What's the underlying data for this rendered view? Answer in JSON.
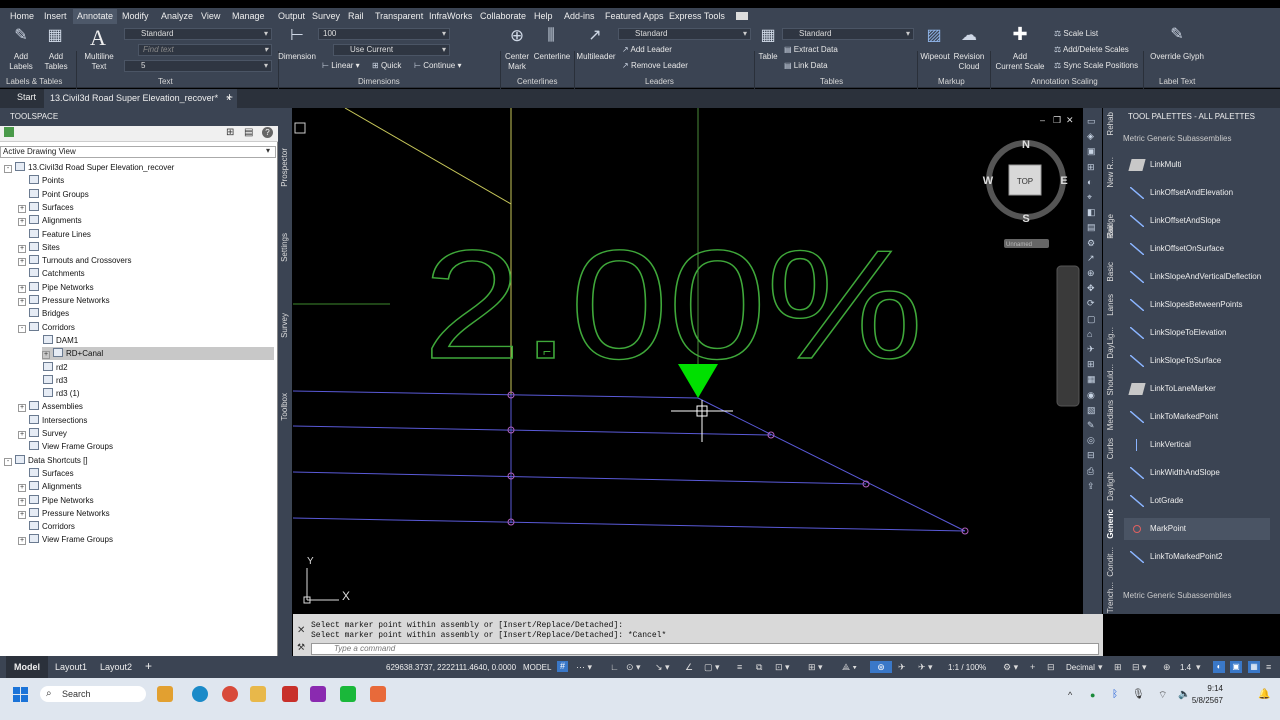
{
  "menu": [
    "Home",
    "Insert",
    "Annotate",
    "Modify",
    "Analyze",
    "View",
    "Manage",
    "Output",
    "Survey",
    "Rail",
    "Transparent",
    "InfraWorks",
    "Collaborate",
    "Help",
    "Add-ins",
    "Featured Apps",
    "Express Tools"
  ],
  "ribbon": {
    "add_labels": "Add\nLabels",
    "add_tables": "Add\nTables",
    "multiline_text": "Multiline\nText",
    "text_style": "Standard",
    "find_text_placeholder": "Find text",
    "text_height": "5",
    "dimension": "Dimension",
    "dim_scale": "100",
    "use_current": "Use Current",
    "linear": "Linear",
    "quick": "Quick",
    "continue": "Continue",
    "center_mark": "Center\nMark",
    "centerline": "Centerline",
    "multileader": "Multileader",
    "leader_style": "Standard",
    "add_leader": "Add Leader",
    "remove_leader": "Remove Leader",
    "table": "Table",
    "table_style": "Standard",
    "extract_data": "Extract Data",
    "link_data": "Link Data",
    "wipeout": "Wipeout",
    "revision_cloud": "Revision\nCloud",
    "add_current_scale": "Add\nCurrent Scale",
    "scale_list": "Scale List",
    "add_delete_scales": "Add/Delete Scales",
    "sync_scale_positions": "Sync Scale Positions",
    "override_glyph": "Override Glyph",
    "groups": {
      "labels_tables": "Labels & Tables",
      "text": "Text",
      "dimensions": "Dimensions",
      "centerlines": "Centerlines",
      "leaders": "Leaders",
      "tables": "Tables",
      "markup": "Markup",
      "annotation_scaling": "Annotation Scaling",
      "label_text": "Label Text"
    }
  },
  "tabs": {
    "start": "Start",
    "document": "13.Civil3d Road Super Elevation_recover*"
  },
  "toolspace": {
    "title": "TOOLSPACE",
    "view": "Active Drawing View",
    "side_tabs": [
      "Prospector",
      "Settings",
      "Survey",
      "Toolbox"
    ],
    "tree": [
      {
        "label": "13.Civil3d Road Super Elevation_recover",
        "indent": 0,
        "exp": "-",
        "bold": true
      },
      {
        "label": "Points",
        "indent": 1,
        "exp": ""
      },
      {
        "label": "Point Groups",
        "indent": 1,
        "exp": ""
      },
      {
        "label": "Surfaces",
        "indent": 1,
        "exp": "+"
      },
      {
        "label": "Alignments",
        "indent": 1,
        "exp": "+"
      },
      {
        "label": "Feature Lines",
        "indent": 1,
        "exp": ""
      },
      {
        "label": "Sites",
        "indent": 1,
        "exp": "+"
      },
      {
        "label": "Turnouts and Crossovers",
        "indent": 1,
        "exp": "+"
      },
      {
        "label": "Catchments",
        "indent": 1,
        "exp": ""
      },
      {
        "label": "Pipe Networks",
        "indent": 1,
        "exp": "+"
      },
      {
        "label": "Pressure Networks",
        "indent": 1,
        "exp": "+"
      },
      {
        "label": "Bridges",
        "indent": 1,
        "exp": ""
      },
      {
        "label": "Corridors",
        "indent": 1,
        "exp": "-"
      },
      {
        "label": "DAM1",
        "indent": 2,
        "exp": ""
      },
      {
        "label": "RD+Canal",
        "indent": 2,
        "exp": "+",
        "sel": true
      },
      {
        "label": "rd2",
        "indent": 2,
        "exp": ""
      },
      {
        "label": "rd3",
        "indent": 2,
        "exp": ""
      },
      {
        "label": "rd3 (1)",
        "indent": 2,
        "exp": ""
      },
      {
        "label": "Assemblies",
        "indent": 1,
        "exp": "+"
      },
      {
        "label": "Intersections",
        "indent": 1,
        "exp": ""
      },
      {
        "label": "Survey",
        "indent": 1,
        "exp": "+"
      },
      {
        "label": "View Frame Groups",
        "indent": 1,
        "exp": ""
      },
      {
        "label": "Data Shortcuts []",
        "indent": 0,
        "exp": "-"
      },
      {
        "label": "Surfaces",
        "indent": 1,
        "exp": ""
      },
      {
        "label": "Alignments",
        "indent": 1,
        "exp": "+"
      },
      {
        "label": "Pipe Networks",
        "indent": 1,
        "exp": "+"
      },
      {
        "label": "Pressure Networks",
        "indent": 1,
        "exp": "+"
      },
      {
        "label": "Corridors",
        "indent": 1,
        "exp": ""
      },
      {
        "label": "View Frame Groups",
        "indent": 1,
        "exp": "+"
      }
    ]
  },
  "drawing": {
    "text": "2.00%",
    "viewcube_top": "TOP",
    "n": "N",
    "s": "S",
    "e": "E",
    "w": "W",
    "ucs_label": "Unnamed",
    "axis_x": "X",
    "axis_y": "Y"
  },
  "command": {
    "line1": "Select marker point within assembly or [Insert/Replace/Detached]:",
    "line2": "Select marker point within assembly or [Insert/Replace/Detached]: *Cancel*",
    "placeholder": "Type a command"
  },
  "palette": {
    "title": "TOOL PALETTES - ALL PALETTES",
    "section": "Metric Generic Subassemblies",
    "footer_section": "Metric Generic Subassemblies",
    "side_tabs": [
      "Rehab",
      "New R...",
      "Bridge",
      "Rail",
      "Basic",
      "Lanes",
      "DayLig...",
      "Should...",
      "Medians",
      "Curbs",
      "Daylight",
      "Generic",
      "Condit...",
      "Trench..."
    ],
    "items": [
      "LinkMulti",
      "LinkOffsetAndElevation",
      "LinkOffsetAndSlope",
      "LinkOffsetOnSurface",
      "LinkSlopeAndVerticalDeflection",
      "LinkSlopesBetweenPoints",
      "LinkSlopeToElevation",
      "LinkSlopeToSurface",
      "LinkToLaneMarker",
      "LinkToMarkedPoint",
      "LinkVertical",
      "LinkWidthAndSlope",
      "LotGrade",
      "MarkPoint",
      "LinkToMarkedPoint2"
    ],
    "selected": "MarkPoint"
  },
  "status": {
    "model_tab": "Model",
    "layout1": "Layout1",
    "layout2": "Layout2",
    "coords": "629638.3737, 2222111.4640, 0.0000",
    "model": "MODEL",
    "scale": "1:1 / 100%",
    "units": "Decimal",
    "zoom": "1.4"
  },
  "taskbar": {
    "search": "Search",
    "time": "9:14",
    "date": "5/8/2567"
  }
}
